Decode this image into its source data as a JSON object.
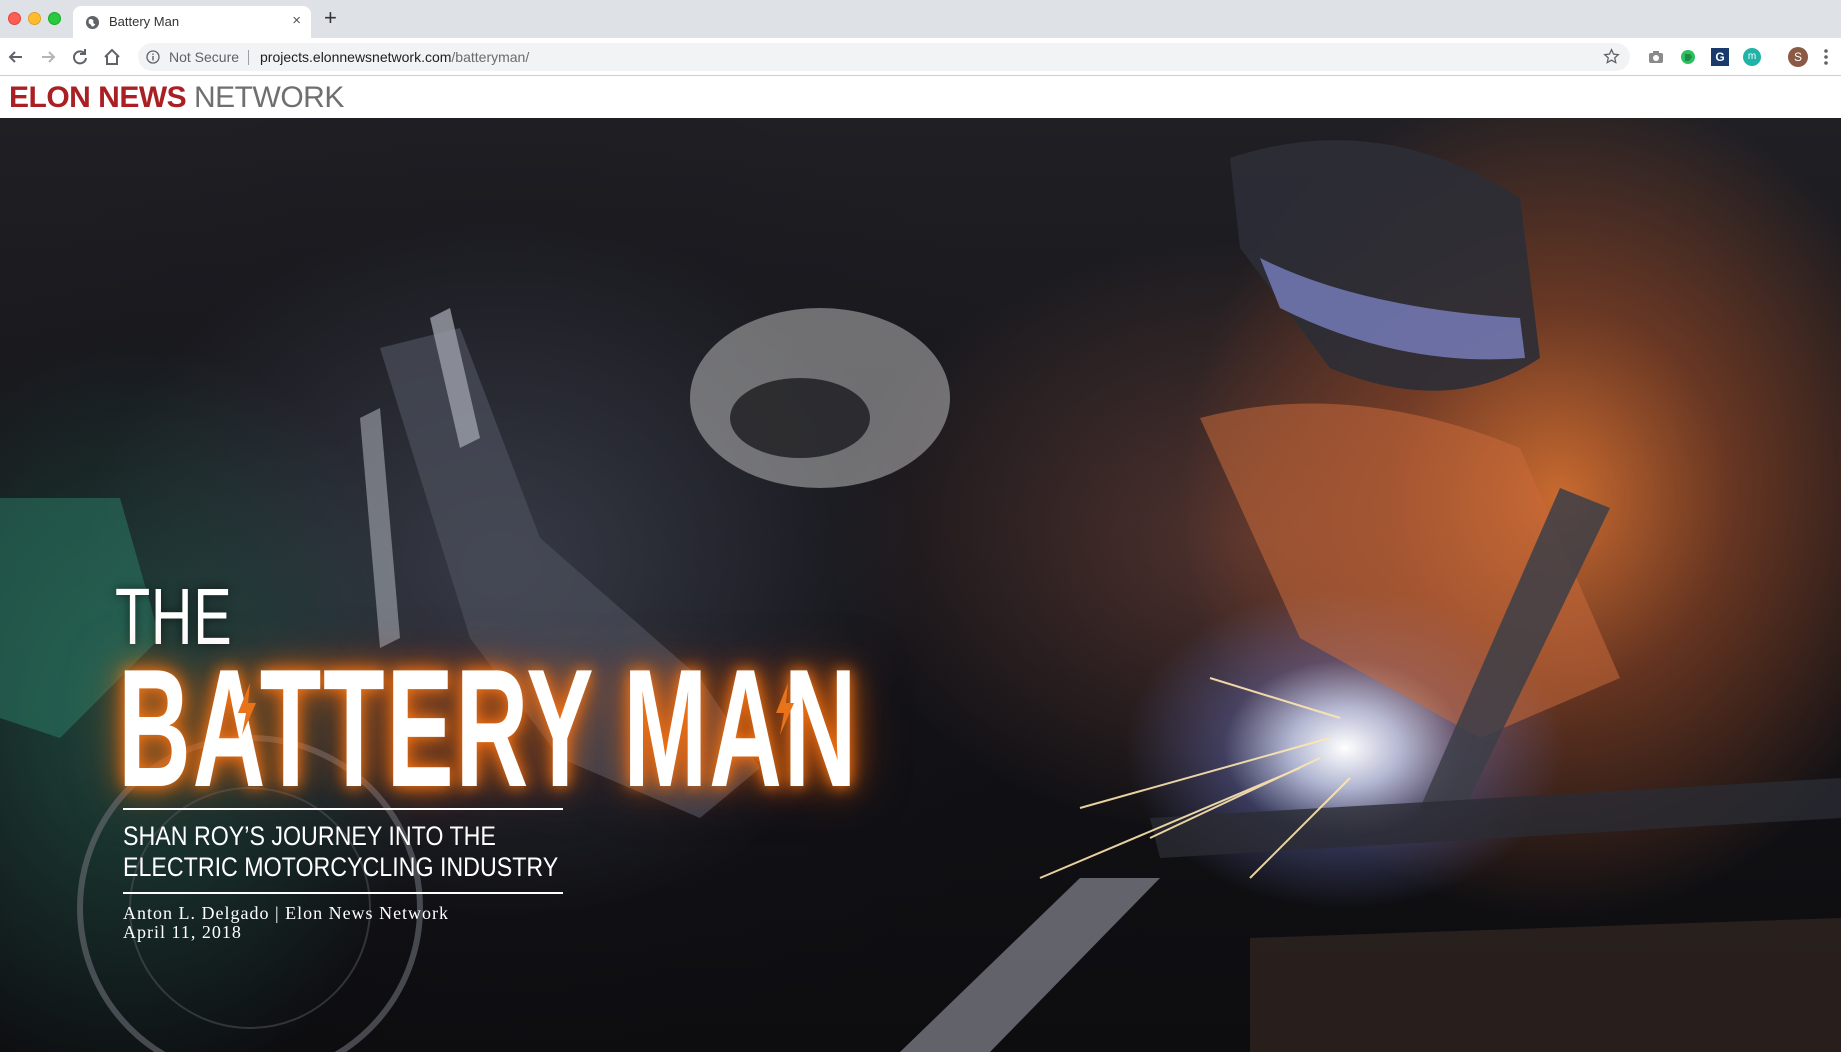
{
  "browser": {
    "tab_title": "Battery Man",
    "tab_close": "×",
    "new_tab": "+",
    "security_label": "Not Secure",
    "url_host": "projects.elonnewsnetwork.com",
    "url_path": "/batteryman/",
    "avatar_letter": "S",
    "extensions": [
      "camera-icon",
      "evernote-icon",
      "grammarly-icon",
      "mercury-icon"
    ]
  },
  "site": {
    "logo_strong": "ELON NEWS",
    "logo_light": " NETWORK"
  },
  "hero": {
    "title_small": "THE",
    "title_big": "BATTERY MAN",
    "subtitle_line1": "SHAN ROY’S JOURNEY INTO THE",
    "subtitle_line2": "ELECTRIC MOTORCYCLING INDUSTRY",
    "byline": "Anton L. Delgado | Elon News Network",
    "date": "April 11, 2018",
    "glow_color": "#ff7a14",
    "brand_color": "#a91f23"
  }
}
